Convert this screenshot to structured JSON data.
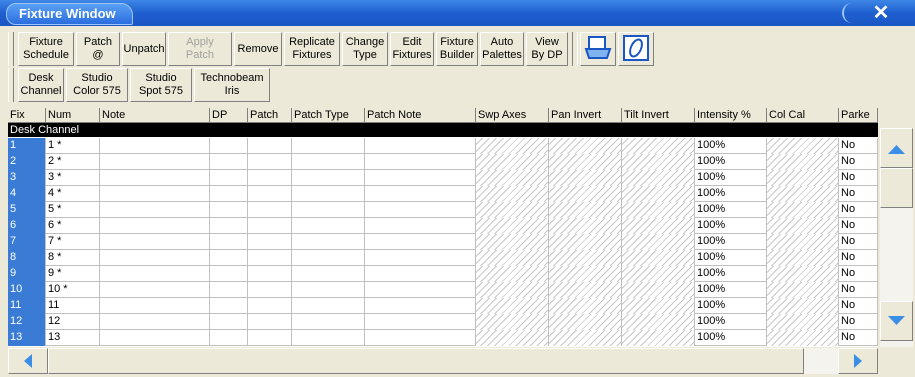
{
  "window": {
    "title": "Fixture Window"
  },
  "toolbar1": [
    {
      "label": "Fixture\nSchedule",
      "enabled": true
    },
    {
      "label": "Patch @",
      "enabled": true
    },
    {
      "label": "Unpatch",
      "enabled": true
    },
    {
      "label": "Apply Patch",
      "enabled": false
    },
    {
      "label": "Remove",
      "enabled": true
    },
    {
      "label": "Replicate\nFixtures",
      "enabled": true
    },
    {
      "label": "Change\nType",
      "enabled": true
    },
    {
      "label": "Edit\nFixtures",
      "enabled": true
    },
    {
      "label": "Fixture\nBuilder",
      "enabled": true
    },
    {
      "label": "Auto\nPalettes",
      "enabled": true
    },
    {
      "label": "View\nBy DP",
      "enabled": true
    }
  ],
  "toolbar1_icons": [
    "printer-icon",
    "notepad-icon"
  ],
  "toolbar2": [
    {
      "label": "Desk\nChannel"
    },
    {
      "label": "Studio\nColor 575"
    },
    {
      "label": "Studio\nSpot 575"
    },
    {
      "label": "Technobeam\nIris"
    }
  ],
  "grid": {
    "headers": [
      "Fix",
      "Num",
      "Note",
      "DP",
      "Patch",
      "Patch Type",
      "Patch Note",
      "Swp Axes",
      "Pan Invert",
      "Tilt Invert",
      "Intensity %",
      "Col Cal",
      "Parke"
    ],
    "group_label": "Desk Channel",
    "rows": [
      {
        "fix": "1",
        "num": "1 *",
        "intensity": "100%",
        "parked": "No"
      },
      {
        "fix": "2",
        "num": "2 *",
        "intensity": "100%",
        "parked": "No"
      },
      {
        "fix": "3",
        "num": "3 *",
        "intensity": "100%",
        "parked": "No"
      },
      {
        "fix": "4",
        "num": "4 *",
        "intensity": "100%",
        "parked": "No"
      },
      {
        "fix": "5",
        "num": "5 *",
        "intensity": "100%",
        "parked": "No"
      },
      {
        "fix": "6",
        "num": "6 *",
        "intensity": "100%",
        "parked": "No"
      },
      {
        "fix": "7",
        "num": "7 *",
        "intensity": "100%",
        "parked": "No"
      },
      {
        "fix": "8",
        "num": "8 *",
        "intensity": "100%",
        "parked": "No"
      },
      {
        "fix": "9",
        "num": "9 *",
        "intensity": "100%",
        "parked": "No"
      },
      {
        "fix": "10",
        "num": "10 *",
        "intensity": "100%",
        "parked": "No"
      },
      {
        "fix": "11",
        "num": "11",
        "intensity": "100%",
        "parked": "No"
      },
      {
        "fix": "12",
        "num": "12",
        "intensity": "100%",
        "parked": "No"
      },
      {
        "fix": "13",
        "num": "13",
        "intensity": "100%",
        "parked": "No"
      }
    ]
  },
  "colors": {
    "title_bar": "#1f5fd0",
    "fix_cell": "#3a7bd5",
    "scroll_arrow": "#3a8ee6"
  }
}
